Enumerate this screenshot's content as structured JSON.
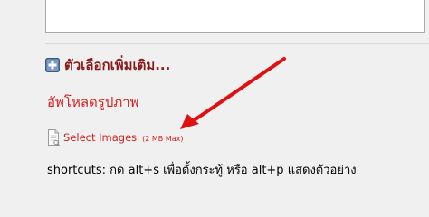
{
  "more_options": {
    "label": "ตัวเลือกเพิ่มเติม...",
    "icon": "plus-square-icon"
  },
  "upload": {
    "link_label": "อัพโหลดรูปภาพ",
    "select_label": "Select Images",
    "max_size": "(2 MB Max)",
    "icon": "file-icon"
  },
  "shortcuts": {
    "text": "shortcuts: กด alt+s เพื่อตั้งกระทู้ หรือ alt+p แสดงตัวอย่าง"
  },
  "annotation": {
    "arrow_color": "#e01010",
    "icon": "arrow-annotation"
  },
  "colors": {
    "link_red": "#d42020",
    "heading_dark_red": "#8b1a1a",
    "background": "#f0f0f0"
  }
}
